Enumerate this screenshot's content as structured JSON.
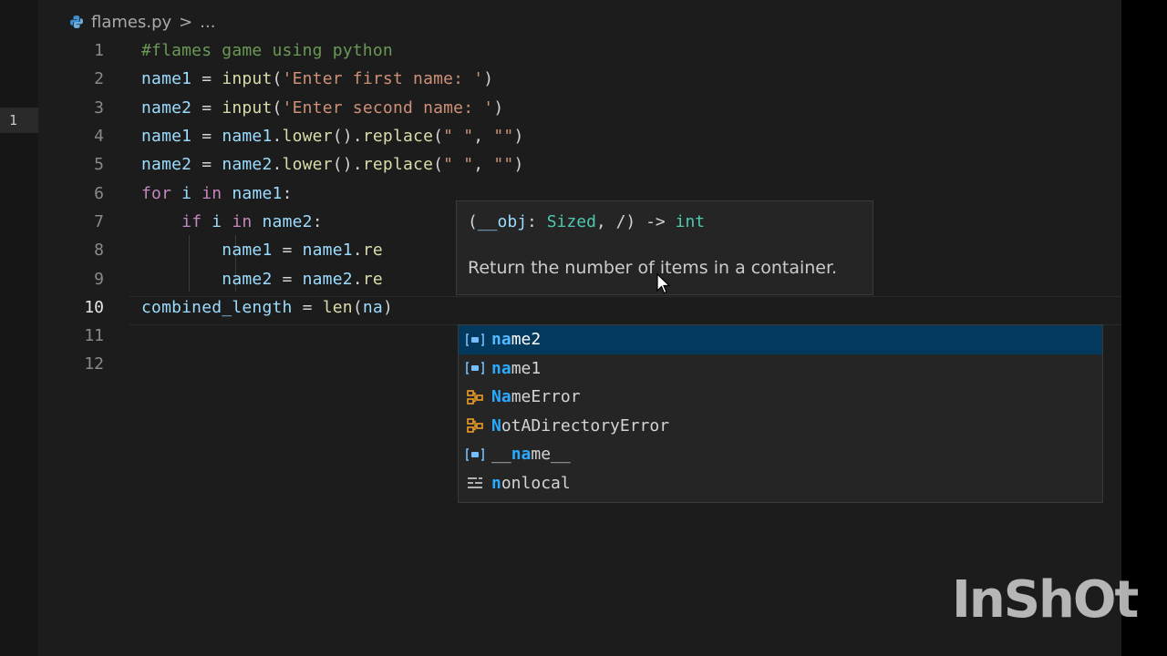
{
  "breadcrumb": {
    "file": "flames.py",
    "separator": ">",
    "tail": "..."
  },
  "gutter_badge": "1",
  "editor": {
    "line_numbers": [
      "1",
      "2",
      "3",
      "4",
      "5",
      "6",
      "7",
      "8",
      "9",
      "10",
      "11",
      "12"
    ],
    "lines": [
      {
        "tokens": [
          {
            "t": "#flames game using python",
            "c": "comment"
          }
        ]
      },
      {
        "tokens": [
          {
            "t": "name1",
            "c": "var"
          },
          {
            "t": " = ",
            "c": "op"
          },
          {
            "t": "input",
            "c": "fn"
          },
          {
            "t": "(",
            "c": "op"
          },
          {
            "t": "'Enter first name: '",
            "c": "str"
          },
          {
            "t": ")",
            "c": "op"
          }
        ]
      },
      {
        "tokens": [
          {
            "t": "name2",
            "c": "var"
          },
          {
            "t": " = ",
            "c": "op"
          },
          {
            "t": "input",
            "c": "fn"
          },
          {
            "t": "(",
            "c": "op"
          },
          {
            "t": "'Enter second name: '",
            "c": "str"
          },
          {
            "t": ")",
            "c": "op"
          }
        ]
      },
      {
        "tokens": [
          {
            "t": "name1",
            "c": "var"
          },
          {
            "t": " = ",
            "c": "op"
          },
          {
            "t": "name1",
            "c": "var"
          },
          {
            "t": ".",
            "c": "op"
          },
          {
            "t": "lower",
            "c": "fn"
          },
          {
            "t": "().",
            "c": "op"
          },
          {
            "t": "replace",
            "c": "fn"
          },
          {
            "t": "(",
            "c": "op"
          },
          {
            "t": "\" \"",
            "c": "str"
          },
          {
            "t": ", ",
            "c": "op"
          },
          {
            "t": "\"\"",
            "c": "str"
          },
          {
            "t": ")",
            "c": "op"
          }
        ]
      },
      {
        "tokens": [
          {
            "t": "name2",
            "c": "var"
          },
          {
            "t": " = ",
            "c": "op"
          },
          {
            "t": "name2",
            "c": "var"
          },
          {
            "t": ".",
            "c": "op"
          },
          {
            "t": "lower",
            "c": "fn"
          },
          {
            "t": "().",
            "c": "op"
          },
          {
            "t": "replace",
            "c": "fn"
          },
          {
            "t": "(",
            "c": "op"
          },
          {
            "t": "\" \"",
            "c": "str"
          },
          {
            "t": ", ",
            "c": "op"
          },
          {
            "t": "\"\"",
            "c": "str"
          },
          {
            "t": ")",
            "c": "op"
          }
        ]
      },
      {
        "tokens": [
          {
            "t": "for",
            "c": "kw"
          },
          {
            "t": " ",
            "c": "op"
          },
          {
            "t": "i",
            "c": "var"
          },
          {
            "t": " ",
            "c": "op"
          },
          {
            "t": "in",
            "c": "kw"
          },
          {
            "t": " ",
            "c": "op"
          },
          {
            "t": "name1",
            "c": "var"
          },
          {
            "t": ":",
            "c": "op"
          }
        ]
      },
      {
        "tokens": [
          {
            "t": "    ",
            "c": "op"
          },
          {
            "t": "if",
            "c": "kw"
          },
          {
            "t": " ",
            "c": "op"
          },
          {
            "t": "i",
            "c": "var"
          },
          {
            "t": " ",
            "c": "op"
          },
          {
            "t": "in",
            "c": "kw"
          },
          {
            "t": " ",
            "c": "op"
          },
          {
            "t": "name2",
            "c": "var"
          },
          {
            "t": ":",
            "c": "op"
          }
        ]
      },
      {
        "tokens": [
          {
            "t": "        ",
            "c": "op"
          },
          {
            "t": "name1",
            "c": "var"
          },
          {
            "t": " = ",
            "c": "op"
          },
          {
            "t": "name1",
            "c": "var"
          },
          {
            "t": ".",
            "c": "op"
          },
          {
            "t": "re",
            "c": "fn"
          }
        ]
      },
      {
        "tokens": [
          {
            "t": "        ",
            "c": "op"
          },
          {
            "t": "name2",
            "c": "var"
          },
          {
            "t": " = ",
            "c": "op"
          },
          {
            "t": "name2",
            "c": "var"
          },
          {
            "t": ".",
            "c": "op"
          },
          {
            "t": "re",
            "c": "fn"
          }
        ]
      },
      {
        "tokens": [
          {
            "t": "combined_length",
            "c": "var"
          },
          {
            "t": " = ",
            "c": "op"
          },
          {
            "t": "len",
            "c": "fn"
          },
          {
            "t": "(",
            "c": "op"
          },
          {
            "t": "na",
            "c": "var"
          },
          {
            "t": ")",
            "c": "op"
          }
        ]
      },
      {
        "tokens": []
      },
      {
        "tokens": []
      }
    ],
    "active_line": 10
  },
  "hover": {
    "signature_open": "(",
    "param": "__obj",
    "colon": ": ",
    "param_type": "Sized",
    "rest": ", /) -> ",
    "return_type": "int",
    "doc": "Return the number of items in a container."
  },
  "suggest": {
    "items": [
      {
        "match": "na",
        "rest": "me2",
        "kind": "variable",
        "selected": true
      },
      {
        "match": "na",
        "rest": "me1",
        "kind": "variable",
        "selected": false
      },
      {
        "match": "Na",
        "rest": "meError",
        "kind": "class",
        "selected": false,
        "prefix": ""
      },
      {
        "match": "N",
        "rest": "otADirectoryError",
        "kind": "class",
        "selected": false
      },
      {
        "prefix": "__",
        "match": "na",
        "rest": "me__",
        "kind": "variable",
        "selected": false
      },
      {
        "match": "n",
        "rest": "onlocal",
        "kind": "keyword",
        "selected": false
      }
    ]
  },
  "watermark": "InShOt",
  "colors": {
    "editor_bg": "#1c1c1c",
    "selection": "#04395e",
    "match_highlight": "#2aaaff",
    "comment": "#6a9955",
    "string": "#ce9178",
    "keyword": "#c586c0",
    "function": "#dcdcaa",
    "variable": "#9cdcfe"
  }
}
